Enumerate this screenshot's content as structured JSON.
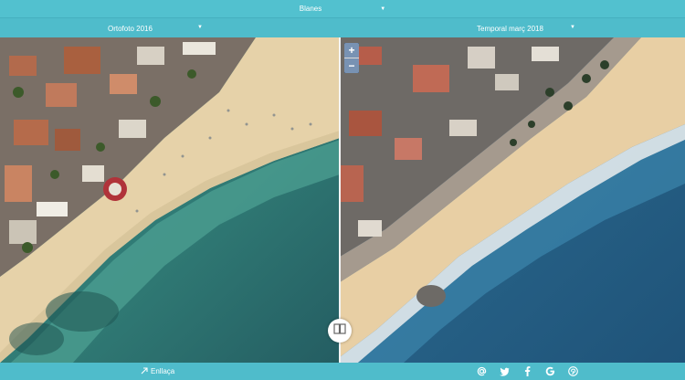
{
  "header": {
    "municipality": "Blanes"
  },
  "layers": {
    "left": {
      "label": "Ortofoto 2016"
    },
    "right": {
      "label": "Temporal març 2018"
    }
  },
  "zoom": {
    "in_label": "+",
    "out_label": "−"
  },
  "footer": {
    "link_label": "Enllaça"
  },
  "social": [
    "email-icon",
    "twitter-icon",
    "facebook-icon",
    "google-icon",
    "pinterest-icon"
  ],
  "colors": {
    "bar": "#52c1cf",
    "sea_left": "#2f7b78",
    "sea_right": "#245e86",
    "sand": "#e7d3ab"
  }
}
